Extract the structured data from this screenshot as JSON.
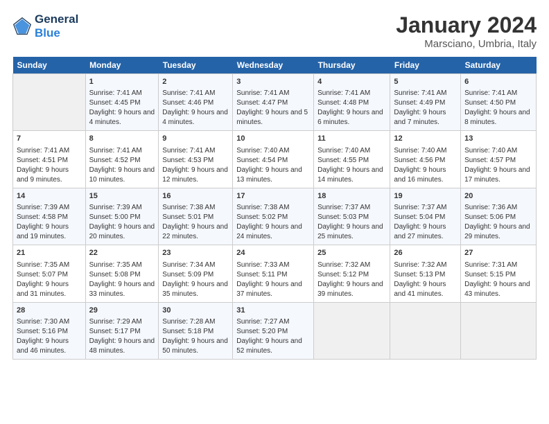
{
  "header": {
    "logo_line1": "General",
    "logo_line2": "Blue",
    "title": "January 2024",
    "subtitle": "Marsciano, Umbria, Italy"
  },
  "days_of_week": [
    "Sunday",
    "Monday",
    "Tuesday",
    "Wednesday",
    "Thursday",
    "Friday",
    "Saturday"
  ],
  "weeks": [
    [
      {
        "date": "",
        "sunrise": "",
        "sunset": "",
        "daylight": ""
      },
      {
        "date": "1",
        "sunrise": "Sunrise: 7:41 AM",
        "sunset": "Sunset: 4:45 PM",
        "daylight": "Daylight: 9 hours and 4 minutes."
      },
      {
        "date": "2",
        "sunrise": "Sunrise: 7:41 AM",
        "sunset": "Sunset: 4:46 PM",
        "daylight": "Daylight: 9 hours and 4 minutes."
      },
      {
        "date": "3",
        "sunrise": "Sunrise: 7:41 AM",
        "sunset": "Sunset: 4:47 PM",
        "daylight": "Daylight: 9 hours and 5 minutes."
      },
      {
        "date": "4",
        "sunrise": "Sunrise: 7:41 AM",
        "sunset": "Sunset: 4:48 PM",
        "daylight": "Daylight: 9 hours and 6 minutes."
      },
      {
        "date": "5",
        "sunrise": "Sunrise: 7:41 AM",
        "sunset": "Sunset: 4:49 PM",
        "daylight": "Daylight: 9 hours and 7 minutes."
      },
      {
        "date": "6",
        "sunrise": "Sunrise: 7:41 AM",
        "sunset": "Sunset: 4:50 PM",
        "daylight": "Daylight: 9 hours and 8 minutes."
      }
    ],
    [
      {
        "date": "7",
        "sunrise": "Sunrise: 7:41 AM",
        "sunset": "Sunset: 4:51 PM",
        "daylight": "Daylight: 9 hours and 9 minutes."
      },
      {
        "date": "8",
        "sunrise": "Sunrise: 7:41 AM",
        "sunset": "Sunset: 4:52 PM",
        "daylight": "Daylight: 9 hours and 10 minutes."
      },
      {
        "date": "9",
        "sunrise": "Sunrise: 7:41 AM",
        "sunset": "Sunset: 4:53 PM",
        "daylight": "Daylight: 9 hours and 12 minutes."
      },
      {
        "date": "10",
        "sunrise": "Sunrise: 7:40 AM",
        "sunset": "Sunset: 4:54 PM",
        "daylight": "Daylight: 9 hours and 13 minutes."
      },
      {
        "date": "11",
        "sunrise": "Sunrise: 7:40 AM",
        "sunset": "Sunset: 4:55 PM",
        "daylight": "Daylight: 9 hours and 14 minutes."
      },
      {
        "date": "12",
        "sunrise": "Sunrise: 7:40 AM",
        "sunset": "Sunset: 4:56 PM",
        "daylight": "Daylight: 9 hours and 16 minutes."
      },
      {
        "date": "13",
        "sunrise": "Sunrise: 7:40 AM",
        "sunset": "Sunset: 4:57 PM",
        "daylight": "Daylight: 9 hours and 17 minutes."
      }
    ],
    [
      {
        "date": "14",
        "sunrise": "Sunrise: 7:39 AM",
        "sunset": "Sunset: 4:58 PM",
        "daylight": "Daylight: 9 hours and 19 minutes."
      },
      {
        "date": "15",
        "sunrise": "Sunrise: 7:39 AM",
        "sunset": "Sunset: 5:00 PM",
        "daylight": "Daylight: 9 hours and 20 minutes."
      },
      {
        "date": "16",
        "sunrise": "Sunrise: 7:38 AM",
        "sunset": "Sunset: 5:01 PM",
        "daylight": "Daylight: 9 hours and 22 minutes."
      },
      {
        "date": "17",
        "sunrise": "Sunrise: 7:38 AM",
        "sunset": "Sunset: 5:02 PM",
        "daylight": "Daylight: 9 hours and 24 minutes."
      },
      {
        "date": "18",
        "sunrise": "Sunrise: 7:37 AM",
        "sunset": "Sunset: 5:03 PM",
        "daylight": "Daylight: 9 hours and 25 minutes."
      },
      {
        "date": "19",
        "sunrise": "Sunrise: 7:37 AM",
        "sunset": "Sunset: 5:04 PM",
        "daylight": "Daylight: 9 hours and 27 minutes."
      },
      {
        "date": "20",
        "sunrise": "Sunrise: 7:36 AM",
        "sunset": "Sunset: 5:06 PM",
        "daylight": "Daylight: 9 hours and 29 minutes."
      }
    ],
    [
      {
        "date": "21",
        "sunrise": "Sunrise: 7:35 AM",
        "sunset": "Sunset: 5:07 PM",
        "daylight": "Daylight: 9 hours and 31 minutes."
      },
      {
        "date": "22",
        "sunrise": "Sunrise: 7:35 AM",
        "sunset": "Sunset: 5:08 PM",
        "daylight": "Daylight: 9 hours and 33 minutes."
      },
      {
        "date": "23",
        "sunrise": "Sunrise: 7:34 AM",
        "sunset": "Sunset: 5:09 PM",
        "daylight": "Daylight: 9 hours and 35 minutes."
      },
      {
        "date": "24",
        "sunrise": "Sunrise: 7:33 AM",
        "sunset": "Sunset: 5:11 PM",
        "daylight": "Daylight: 9 hours and 37 minutes."
      },
      {
        "date": "25",
        "sunrise": "Sunrise: 7:32 AM",
        "sunset": "Sunset: 5:12 PM",
        "daylight": "Daylight: 9 hours and 39 minutes."
      },
      {
        "date": "26",
        "sunrise": "Sunrise: 7:32 AM",
        "sunset": "Sunset: 5:13 PM",
        "daylight": "Daylight: 9 hours and 41 minutes."
      },
      {
        "date": "27",
        "sunrise": "Sunrise: 7:31 AM",
        "sunset": "Sunset: 5:15 PM",
        "daylight": "Daylight: 9 hours and 43 minutes."
      }
    ],
    [
      {
        "date": "28",
        "sunrise": "Sunrise: 7:30 AM",
        "sunset": "Sunset: 5:16 PM",
        "daylight": "Daylight: 9 hours and 46 minutes."
      },
      {
        "date": "29",
        "sunrise": "Sunrise: 7:29 AM",
        "sunset": "Sunset: 5:17 PM",
        "daylight": "Daylight: 9 hours and 48 minutes."
      },
      {
        "date": "30",
        "sunrise": "Sunrise: 7:28 AM",
        "sunset": "Sunset: 5:18 PM",
        "daylight": "Daylight: 9 hours and 50 minutes."
      },
      {
        "date": "31",
        "sunrise": "Sunrise: 7:27 AM",
        "sunset": "Sunset: 5:20 PM",
        "daylight": "Daylight: 9 hours and 52 minutes."
      },
      {
        "date": "",
        "sunrise": "",
        "sunset": "",
        "daylight": ""
      },
      {
        "date": "",
        "sunrise": "",
        "sunset": "",
        "daylight": ""
      },
      {
        "date": "",
        "sunrise": "",
        "sunset": "",
        "daylight": ""
      }
    ]
  ]
}
